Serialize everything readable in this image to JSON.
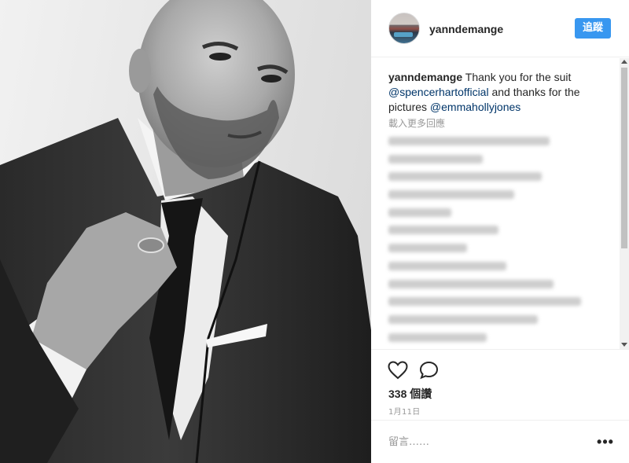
{
  "post": {
    "username": "yanndemange",
    "follow_label": "追蹤",
    "caption": {
      "user": "yanndemange",
      "text_1": " Thank you for the suit ",
      "mention_1": "@spencerhartofficial",
      "text_2": " and thanks for the pictures ",
      "mention_2": "@emmahollyjones"
    },
    "load_more_label": "載入更多回應",
    "likes_label": "338 個讚",
    "date_label": "1月11日",
    "comment_placeholder": "留言……",
    "more_options_label": "•••"
  },
  "icons": {
    "like": "heart-icon",
    "comment": "speech-bubble-icon",
    "more": "ellipsis-icon"
  },
  "colors": {
    "accent": "#3897f0",
    "mention": "#003569",
    "muted": "#999999"
  }
}
